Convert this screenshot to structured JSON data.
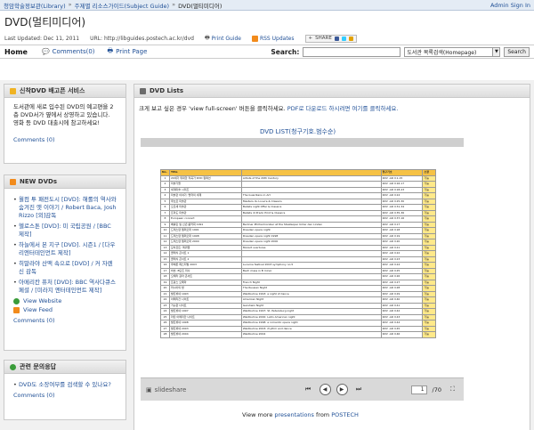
{
  "topbar": {
    "crumbs": [
      "청암학술정보관(Library)",
      "주제별 리소스가이드(Subject Guide)",
      "DVD(멀티미디어)"
    ],
    "admin": "Admin Sign In"
  },
  "page": {
    "title": "DVD(멀티미디어)"
  },
  "meta": {
    "last_updated": "Last Updated: Dec 11, 2011",
    "url": "URL: http://libguides.postech.ac.kr/dvd",
    "print_guide": "Print Guide",
    "rss": "RSS Updates",
    "share": "SHARE"
  },
  "nav": {
    "home": "Home",
    "comments": "Comments(0)",
    "print_page": "Print Page",
    "search_label": "Search:",
    "search_placeholder": "",
    "select_value": "도서관 목록검색(Homepage)",
    "search_button": "Search"
  },
  "sidebar": {
    "box1": {
      "title": "신착DVD 배고픈 서비스",
      "text": "도서관에 새로 입수된 DVD의 예고편을 2층 DVD서가 옆에서 상영하고 있습니다. 영화 등 DVD 대출시에 참고하세요!",
      "comments": "Comments (0)"
    },
    "box2": {
      "title": "NEW DVDs",
      "items": [
        "월컴 투 패전도시 [DVD]: 해롤의 역사와 숨겨진 옛 이야기 / Robert Baca, Josh Rizzo [외]감독",
        "헬로스톤 [DVD]: 미 국립공원 / [BBC 제작]",
        "하늘에서 본 지구 [DVD]. 시즌1 / [다우리엔터테인먼트 제작]",
        "히말라야 산맥 속으로 [DVD] / 커 자렌신 감독",
        "아메리칸 퓨처 [DVD]: BBC 역사다큐스페셜 / [미라지 엔터테인먼트 제작]"
      ],
      "view_website": "View Website",
      "view_feed": "View Feed",
      "comments": "Comments (0)"
    },
    "box3": {
      "title": "관련 문의응답",
      "items": [
        "DVD도 소장여부를 검색할 수 있나요?"
      ],
      "comments": "Comments (0)"
    }
  },
  "content": {
    "box_title": "DVD Lists",
    "intro_prefix": "크게 보고 싶은 경우 'view full-screen' 버튼을 클릭하세요. ",
    "intro_link": "PDF로 다운로드 하시려면 여기를 클릭하세요.",
    "list_title": "DVD LIST(청구기호.범수순)",
    "viewer": {
      "brand": "slideshare",
      "page_current": "1",
      "page_total": "/70"
    },
    "view_more_prefix": "View more ",
    "view_more_link1": "presentations",
    "view_more_mid": " from ",
    "view_more_link2": "POSTECH"
  },
  "slide_table": {
    "headers": [
      "No.",
      "Title",
      "",
      "청구기호",
      "소장"
    ],
    "rows": [
      [
        "1",
        "20세기 위대한 작곡가 DVD 컬렉션",
        "Artists of the 20th Century",
        "KDV .AR V.1-15",
        "가능"
      ],
      [
        "2",
        "미술가들",
        "",
        "KDV .AR V.16-17",
        "가능"
      ],
      [
        "3",
        "세계미술 시리즈",
        "",
        "KDV .AR V.18-23",
        "가능"
      ],
      [
        "4",
        "미술관 이야기: 명작의 세계",
        "The Guardians in Art",
        "KDV .AR V.24",
        "가능"
      ],
      [
        "5",
        "루브르 미술관",
        "Masters du Louvre & Classics",
        "KDV .AR V.25-30",
        "가능"
      ],
      [
        "6",
        "오르세 미술관",
        "Ballets night Offer & Classics",
        "KDV .AR V.31-34",
        "가능"
      ],
      [
        "7",
        "프라도 미술관",
        "Ballets di Prado Print & Classics",
        "KDV .AR V.35-36",
        "가능"
      ],
      [
        "8",
        "European concert",
        "",
        "KDV .AR V.37-16",
        "가능"
      ],
      [
        "9",
        "베를린 필 신년 음악회 1991",
        "Berliner Philharmoniker at the Staatsoper Unter den Linden",
        "KDV .AR V.17",
        "가능"
      ],
      [
        "10",
        "드레스덴 젬퍼오퍼 1991",
        "Dresden opera night",
        "KDV .AR V.18",
        "가능"
      ],
      [
        "11",
        "드레스덴 젬퍼오퍼 1998",
        "Dresden opera night 1998",
        "KDV .AR V.19",
        "가능"
      ],
      [
        "12",
        "드레스덴 젬퍼오퍼 2000",
        "Dresden opera night 2000",
        "KDV .AR V.20",
        "가능"
      ],
      [
        "13",
        "모차르트: 레퀴엠",
        "Mozart overtures",
        "KDV .AR V.21",
        "가능"
      ],
      [
        "14",
        "클래식 콘서트 1",
        "",
        "KDV .AR V.22",
        "가능"
      ],
      [
        "15",
        "클래식 콘서트 2",
        "",
        "KDV .AR V.23",
        "가능"
      ],
      [
        "16",
        "루체른 페스티벌 2003",
        "Lucerne festival 2003 symphony no.5",
        "KDV .AR V.24",
        "가능"
      ],
      [
        "17",
        "바흐: B단조 미사",
        "Bach mass in B minor",
        "KDV .AR V.25",
        "가능"
      ],
      [
        "18",
        "오페라 갈라 콘서트",
        "",
        "KDV .AR V.26",
        "가능"
      ],
      [
        "19",
        "프랑스 오페라",
        "French Night",
        "KDV .AR V.27",
        "가능"
      ],
      [
        "20",
        "러시아의 밤",
        "The Russian Night",
        "KDV .AR V.28",
        "가능"
      ],
      [
        "21",
        "발트뷔네 1993",
        "Waldbuhne 1993: a night of dance",
        "KDV .AR V.29",
        "가능"
      ],
      [
        "22",
        "아메리칸 나이트",
        "American Night",
        "KDV .AR V.40",
        "가능"
      ],
      [
        "23",
        "거슈윈 나이트",
        "Gershwin Night",
        "KDV .AR V.41",
        "가능"
      ],
      [
        "24",
        "발트뷔네 1997",
        "Waldbuhne 1997: St. Petersburg night",
        "KDV .AR V.42",
        "가능"
      ],
      [
        "25",
        "라틴 아메리칸 나이트",
        "Waldbuhne 2000: Latin American night",
        "KDV .AR V.43",
        "가능"
      ],
      [
        "26",
        "발트뷔네 1998",
        "Waldbuhne 1998: a romantic opera night",
        "KDV .AR V.44",
        "가능"
      ],
      [
        "27",
        "발트뷔네 2003",
        "Waldbuhne 2003: rhythm and dance",
        "KDV .AR V.45",
        "가능"
      ],
      [
        "28",
        "발트뷔네 2004",
        "Waldbuhne 2004",
        "KDV .AR V.46",
        "가능"
      ]
    ]
  },
  "colors": {
    "link": "#1f4f96",
    "header_gold": "#f6c245",
    "box_border": "#c9c9c9"
  }
}
